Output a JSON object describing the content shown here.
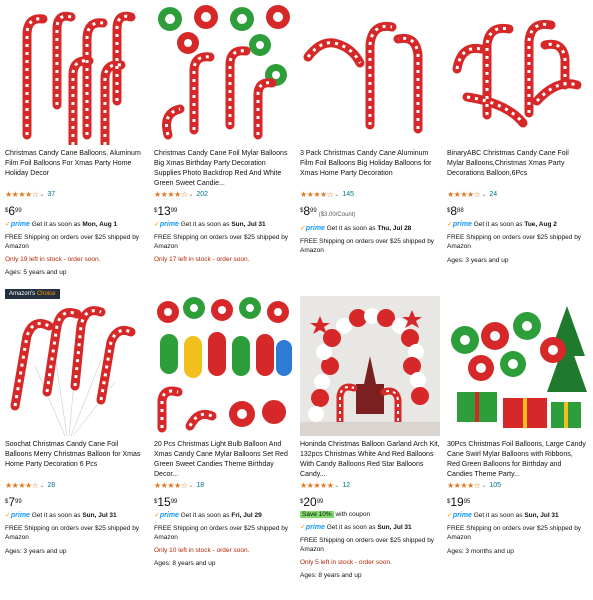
{
  "products": [
    {
      "title": "Christmas Candy Cane Balloons, Aluminum Film Foil Balloons For Xmas Party Home Holiday Decor",
      "stars": "★★★★☆",
      "reviews": "37",
      "price_symbol": "$",
      "price_whole": "6",
      "price_fraction": "99",
      "unit_price": "",
      "coupon_tag": "",
      "coupon_text": "",
      "prime_label": "prime",
      "delivery_text": "Get it as soon as",
      "delivery_date": "Mon, Aug 1",
      "shipping": "FREE Shipping on orders over $25 shipped by Amazon",
      "stock": "Only 19 left in stock - order soon.",
      "ages": "Ages: 5 years and up",
      "badge": ""
    },
    {
      "title": "Christmas Candy Cane Foil Mylar Balloons Big Xmas Birthday Party Decoration Supplies Photo Backdrop Red And White Green Sweet Candie...",
      "stars": "★★★★☆",
      "reviews": "202",
      "price_symbol": "$",
      "price_whole": "13",
      "price_fraction": "99",
      "unit_price": "",
      "coupon_tag": "",
      "coupon_text": "",
      "prime_label": "prime",
      "delivery_text": "Get it as soon as",
      "delivery_date": "Sun, Jul 31",
      "shipping": "FREE Shipping on orders over $25 shipped by Amazon",
      "stock": "Only 17 left in stock - order soon.",
      "ages": "",
      "badge": ""
    },
    {
      "title": "3 Pack Christmas Candy Cane Aluminum Film Foil Balloons Big Holiday Balloons for Xmas Home Party Decoration",
      "stars": "★★★★☆",
      "reviews": "145",
      "price_symbol": "$",
      "price_whole": "8",
      "price_fraction": "99",
      "unit_price": "($3.00/Count)",
      "coupon_tag": "",
      "coupon_text": "",
      "prime_label": "prime",
      "delivery_text": "Get it as soon as",
      "delivery_date": "Thu, Jul 28",
      "shipping": "FREE Shipping on orders over $25 shipped by Amazon",
      "stock": "",
      "ages": "",
      "badge": ""
    },
    {
      "title": "BinaryABC Christmas Candy Cane Foil Mylar Balloons,Christmas Xmas Party Decorations Balloon,6Pcs",
      "stars": "★★★★☆",
      "reviews": "24",
      "price_symbol": "$",
      "price_whole": "8",
      "price_fraction": "88",
      "unit_price": "",
      "coupon_tag": "",
      "coupon_text": "",
      "prime_label": "prime",
      "delivery_text": "Get it as soon as",
      "delivery_date": "Tue, Aug 2",
      "shipping": "FREE Shipping on orders over $25 shipped by Amazon",
      "stock": "",
      "ages": "Ages: 3 years and up",
      "badge": ""
    },
    {
      "title": "Soochat Christmas Candy Cane Foil Balloons Merry Christmas Balloon for Xmas Home Party Decoration 6 Pcs",
      "stars": "★★★★☆",
      "reviews": "28",
      "price_symbol": "$",
      "price_whole": "7",
      "price_fraction": "99",
      "unit_price": "",
      "coupon_tag": "",
      "coupon_text": "",
      "prime_label": "prime",
      "delivery_text": "Get it as soon as",
      "delivery_date": "Sun, Jul 31",
      "shipping": "FREE Shipping on orders over $25 shipped by Amazon",
      "stock": "",
      "ages": "Ages: 3 years and up",
      "badge": "Amazon's Choice"
    },
    {
      "title": "20 Pcs Christmas Light Bulb Balloon And Xmas Candy Cane Mylar Balloons Set Red Green Sweet Candies Theme Birthday Decor...",
      "stars": "★★★★☆",
      "reviews": "18",
      "price_symbol": "$",
      "price_whole": "15",
      "price_fraction": "99",
      "unit_price": "",
      "coupon_tag": "",
      "coupon_text": "",
      "prime_label": "prime",
      "delivery_text": "Get it as soon as",
      "delivery_date": "Fri, Jul 29",
      "shipping": "FREE Shipping on orders over $25 shipped by Amazon",
      "stock": "Only 10 left in stock - order soon.",
      "ages": "Ages: 8 years and up",
      "badge": ""
    },
    {
      "title": "Honinda Christmas Balloon Garland Arch Kit, 132pcs Christmas White And Red Balloons With Candy Balloons Red Star Balloons Candy...",
      "stars": "★★★★★",
      "reviews": "12",
      "price_symbol": "$",
      "price_whole": "20",
      "price_fraction": "99",
      "unit_price": "",
      "coupon_tag": "Save 10%",
      "coupon_text": "with coupon",
      "prime_label": "prime",
      "delivery_text": "Get it as soon as",
      "delivery_date": "Sun, Jul 31",
      "shipping": "FREE Shipping on orders over $25 shipped by Amazon",
      "stock": "Only 5 left in stock - order soon.",
      "ages": "Ages: 8 years and up",
      "badge": ""
    },
    {
      "title": "30Pcs Christmas Foil Balloons, Large Candy Cane Swirl Mylar Balloons with Ribbons, Red Green Balloons for Birthday and Candies Theme Party...",
      "stars": "★★★★☆",
      "reviews": "105",
      "price_symbol": "$",
      "price_whole": "19",
      "price_fraction": "95",
      "unit_price": "",
      "coupon_tag": "",
      "coupon_text": "",
      "prime_label": "prime",
      "delivery_text": "Get it as soon as",
      "delivery_date": "Sun, Jul 31",
      "shipping": "FREE Shipping on orders over $25 shipped by Amazon",
      "stock": "",
      "ages": "Ages: 3 months and up",
      "badge": ""
    }
  ],
  "colors": {
    "star": "#de7921",
    "link": "#007185",
    "prime": "#1399ff",
    "stock": "#b12704",
    "coupon": "#7fda69",
    "cane_red": "#d62828",
    "cane_green": "#2e9e3a"
  }
}
